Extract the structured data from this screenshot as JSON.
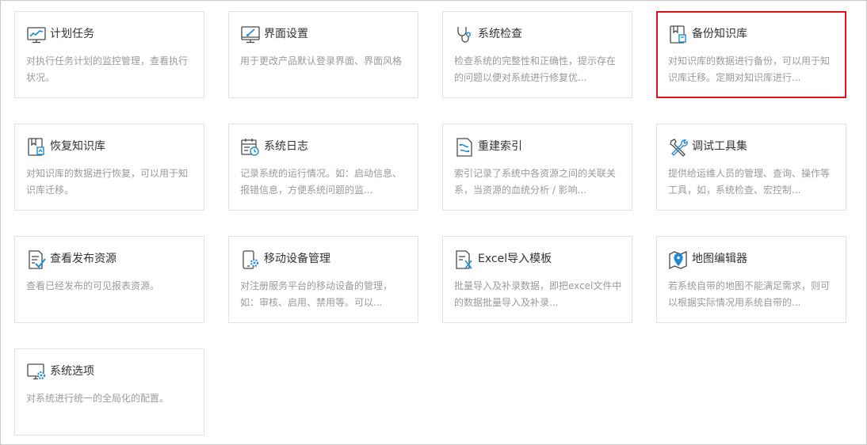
{
  "colors": {
    "accent": "#e0121b",
    "icon_blue": "#1e8ad6",
    "icon_dark": "#4a4a4a",
    "title": "#333333",
    "desc": "#9a9a9a",
    "card_border": "#e1e1e1"
  },
  "cards": [
    {
      "title": "计划任务",
      "desc": "对执行任务计划的监控管理，查看执行\n状况。",
      "icon": "monitor-chart-icon",
      "selected": false
    },
    {
      "title": "界面设置",
      "desc": "用于更改产品默认登录界面、界面风格",
      "icon": "monitor-brush-icon",
      "selected": false
    },
    {
      "title": "系统检查",
      "desc": "检查系统的完整性和正确性，提示存在\n的问题以便对系统进行修复优...",
      "icon": "stethoscope-icon",
      "selected": false
    },
    {
      "title": "备份知识库",
      "desc": "对知识库的数据进行备份，可以用于知\n识库迁移。定期对知识库进行...",
      "icon": "book-backup-icon",
      "selected": true
    },
    {
      "title": "恢复知识库",
      "desc": "对知识库的数据进行恢复，可以用于知\n识库迁移。",
      "icon": "book-restore-icon",
      "selected": false
    },
    {
      "title": "系统日志",
      "desc": "记录系统的运行情况。如：启动信息、\n报错信息，方便系统问题的监...",
      "icon": "calendar-clock-icon",
      "selected": false
    },
    {
      "title": "重建索引",
      "desc": "索引记录了系统中各资源之间的关联关\n系，当资源的血统分析 / 影响...",
      "icon": "document-index-icon",
      "selected": false
    },
    {
      "title": "调试工具集",
      "desc": "提供给运维人员的管理、查询、操作等\n工具，如，系统检查、宏控制...",
      "icon": "tools-icon",
      "selected": false
    },
    {
      "title": "查看发布资源",
      "desc": "查看已经发布的可见报表资源。",
      "icon": "document-check-icon",
      "selected": false
    },
    {
      "title": "移动设备管理",
      "desc": "对注册服务平台的移动设备的管理，\n如：审核、启用、禁用等。可以...",
      "icon": "mobile-gear-icon",
      "selected": false
    },
    {
      "title": "Excel导入模板",
      "desc": "批量导入及补录数据，即把excel文件中\n的数据批量导入及补录...",
      "icon": "excel-document-icon",
      "selected": false
    },
    {
      "title": "地图编辑器",
      "desc": "若系统自带的地图不能满足需求，则可\n以根据实际情况用系统自带的...",
      "icon": "map-pin-icon",
      "selected": false
    },
    {
      "title": "系统选项",
      "desc": "对系统进行统一的全局化的配置。",
      "icon": "monitor-gear-icon",
      "selected": false
    }
  ]
}
